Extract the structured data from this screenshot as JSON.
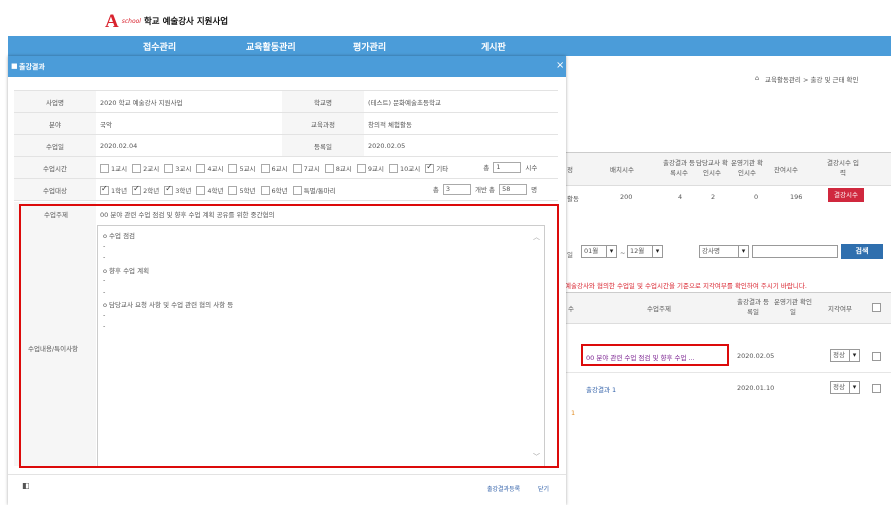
{
  "header": {
    "logo_letter": "A",
    "logo_small": "school",
    "title": "학교 예술강사 지원사업",
    "nav": [
      "접수관리",
      "교육활동관리",
      "평가관리",
      "게시판"
    ]
  },
  "background_page": {
    "breadcrumb": "교육활동관리 > 출강 및 근태 확인",
    "columns": [
      "정",
      "배치시수",
      "출강결과 등록시수",
      "담당교사 확인시수",
      "운영기관 확인시수",
      "잔여시수",
      "결강시수 입력"
    ],
    "row": {
      "type": "활동",
      "배치시수": "200",
      "출강결과": "4",
      "담당교사": "2",
      "운영기관": "0",
      "잔여시수": "196",
      "button": "결강시수"
    },
    "filter": {
      "label": "일",
      "from_month": "01월",
      "dash": "~",
      "to_month": "12월",
      "status_select": "강사명",
      "search_button": "검색"
    },
    "notice": "예술강사와 협의한 수업일 및 수업시간을 기준으로 지각여부를 확인하여 주시기 바랍니다.",
    "list_columns": [
      "수",
      "수업주제",
      "출강결과 등록일",
      "운영기관 확인일",
      "지각여부"
    ],
    "list_rows": [
      {
        "subject": "00 분야 관련 수업 점검 및 향후 수업 ...",
        "date": "2020.02.05",
        "status": "정상"
      },
      {
        "subject": "출강결과 1",
        "date": "2020.01.10",
        "status": "정상"
      }
    ],
    "marker": "1"
  },
  "modal": {
    "title": "출강결과",
    "close_icon": "×",
    "fields": {
      "business_label": "사업명",
      "business_value": "2020 학교 예술강사 지원사업",
      "school_label": "학교명",
      "school_value": "(테스트) 문화예술초등학교",
      "area_label": "분야",
      "area_value": "국악",
      "course_label": "교육과정",
      "course_value": "창의적 체험활동",
      "class_date_label": "수업일",
      "class_date_value": "2020.02.04",
      "reg_date_label": "등록일",
      "reg_date_value": "2020.02.05",
      "class_time_label": "수업시간",
      "class_time_options": [
        "1교시",
        "2교시",
        "3교시",
        "4교시",
        "5교시",
        "6교시",
        "7교시",
        "8교시",
        "9교시",
        "10교시",
        "기타"
      ],
      "class_time_checked": [
        false,
        false,
        false,
        false,
        false,
        false,
        false,
        false,
        false,
        false,
        true
      ],
      "time_total_label": "총",
      "time_total_value": "1",
      "time_unit": "시수",
      "target_label": "수업대상",
      "target_options": [
        "1학년",
        "2학년",
        "3학년",
        "4학년",
        "5학년",
        "6학년",
        "특별/통마리"
      ],
      "target_checked": [
        true,
        true,
        true,
        false,
        false,
        false,
        false
      ],
      "class_total_label": "총",
      "class_total_value": "3",
      "student_label": "개반 총",
      "student_value": "58",
      "student_unit": "명",
      "topic_label": "수업주제",
      "topic_value": "00 분야 관련 수업 점검 및 향후 수업 계획 공유를 위한 중간협의",
      "content_label": "수업내용/특이사항",
      "content_lines": [
        "o 수업 점검",
        "-",
        "-",
        "o 향후 수업 계획",
        "-",
        "-",
        "o 담당교사 요청 사항 및 수업 관련 협의 사항 등",
        "-",
        "-"
      ]
    },
    "footer": {
      "register_button": "출강결과등록",
      "close_button": "닫기"
    }
  }
}
